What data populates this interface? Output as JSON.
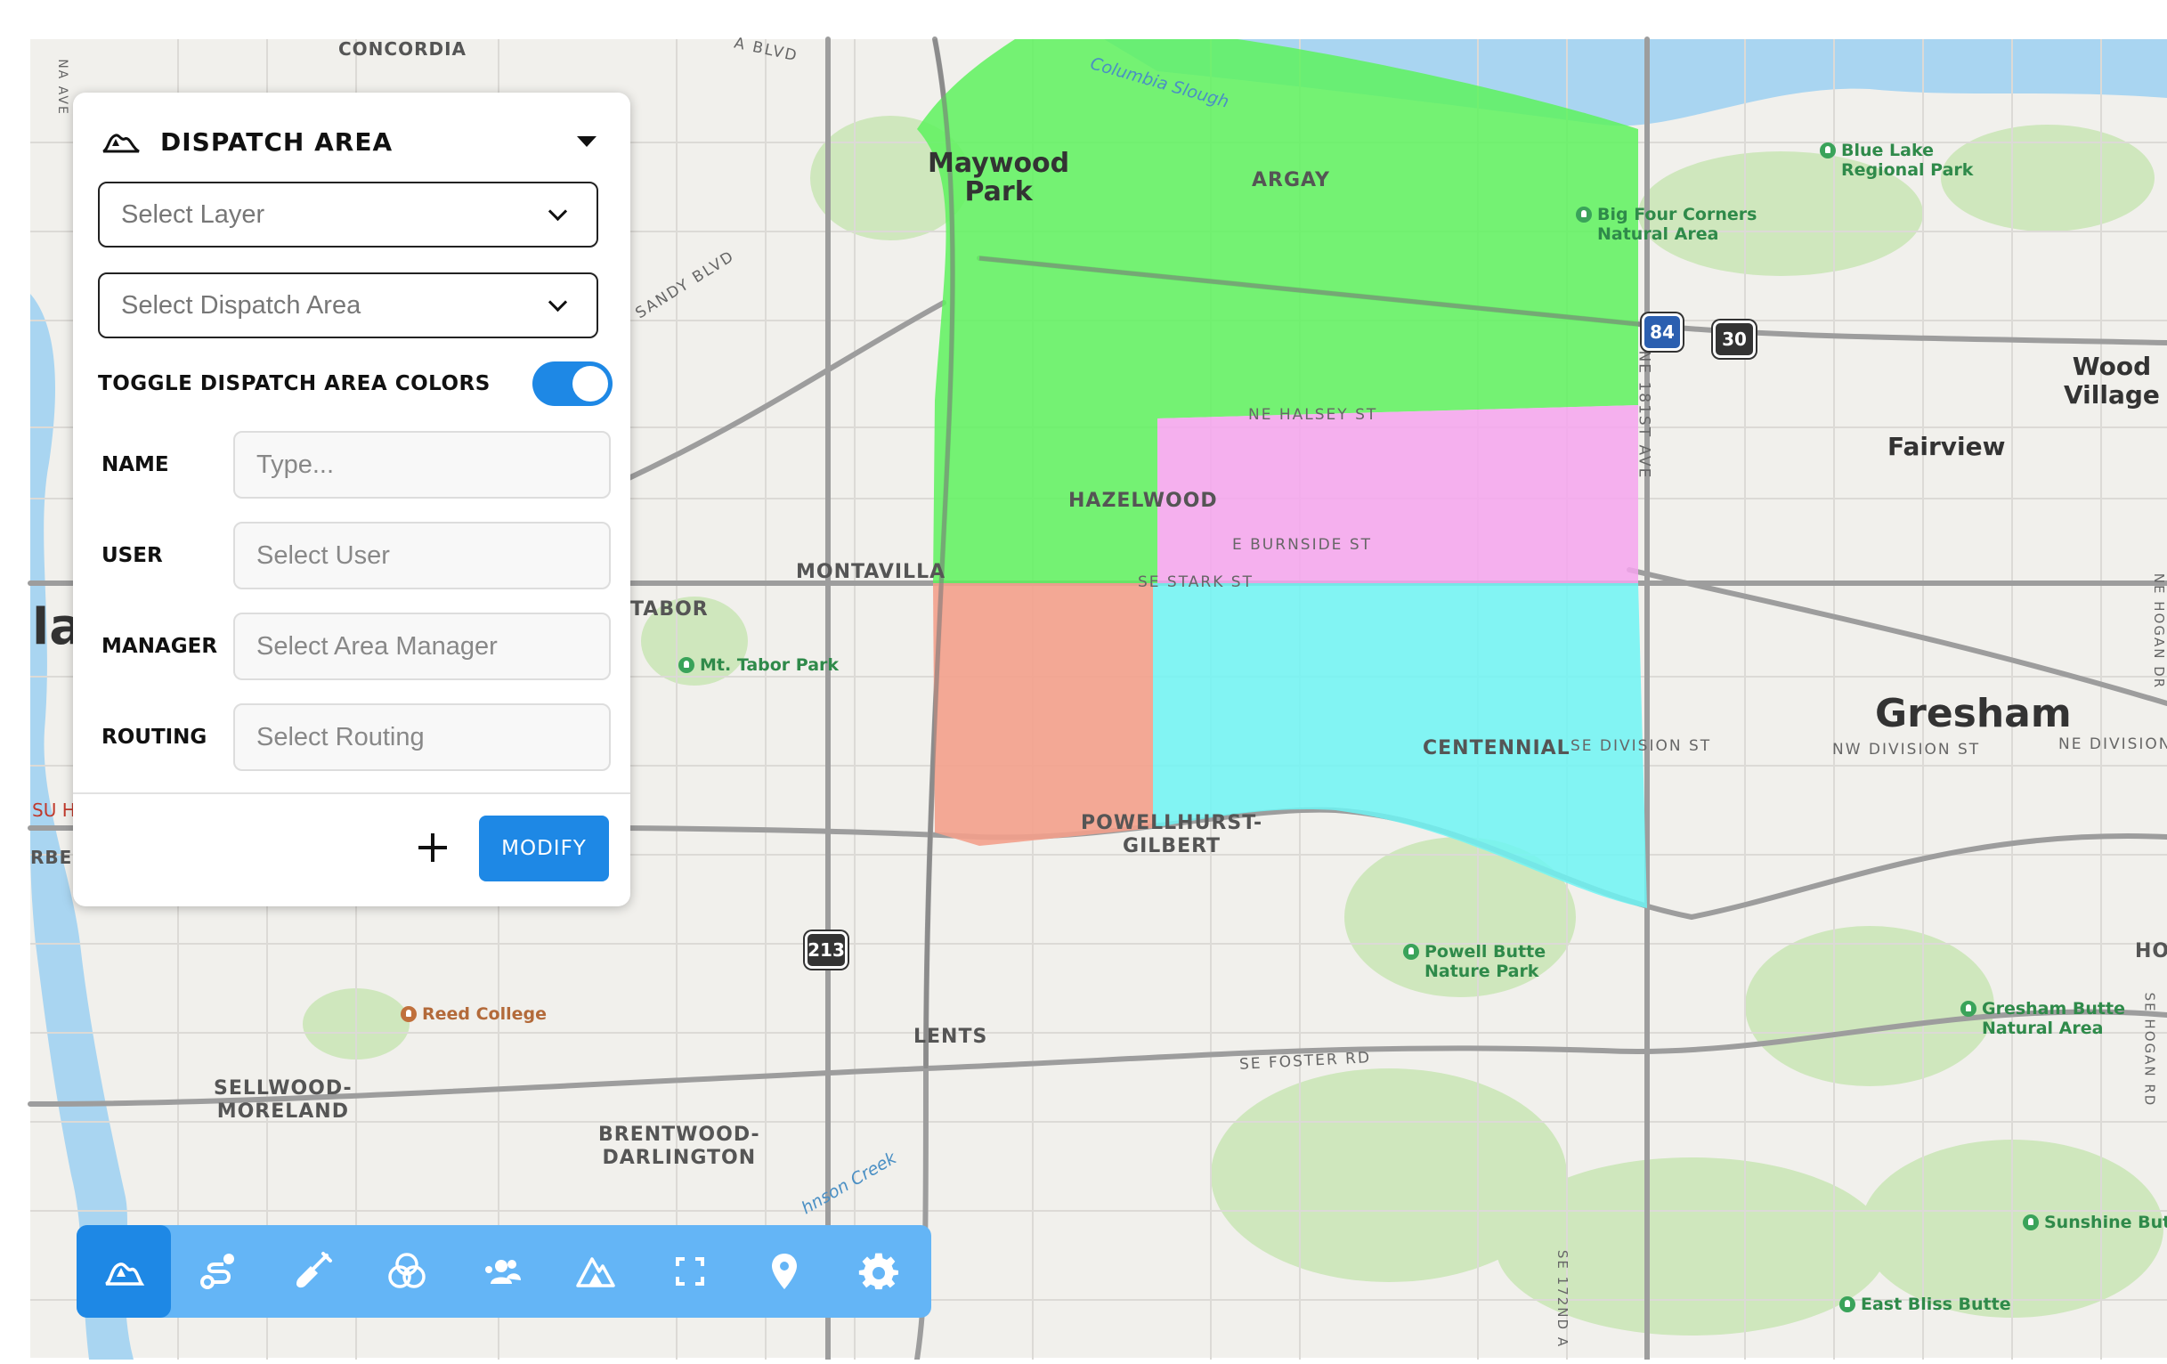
{
  "map": {
    "neighborhoods": [
      "CONCORDIA",
      "ARGAY",
      "HAZELWOOD",
      "MONTAVILLA",
      "TABOR",
      "CENTENNIAL",
      "POWELLHURST-\nGILBERT",
      "LENTS",
      "SELLWOOD-\nMORELAND",
      "BRENTWOOD-\nDARLINGTON",
      "HOG"
    ],
    "cities": [
      "Maywood\nPark",
      "Wood\nVillage",
      "Fairview",
      "Gresham"
    ],
    "streets": [
      "NE HALSEY ST",
      "E BURNSIDE ST",
      "SE STARK ST",
      "SE DIVISION ST",
      "NW DIVISION ST",
      "NE DIVISION",
      "SE FOSTER RD",
      "NE 181ST AVE",
      "SANDY BLVD",
      "A BLVD",
      "NA AVE",
      "SE 172ND A",
      "NE HOGAN DR",
      "SE HOGAN RD",
      "Columbia Slough",
      "hnson Creek"
    ],
    "pois": [
      "Blue Lake\nRegional Park",
      "Big Four Corners\nNatural Area",
      "Mt. Tabor Park",
      "Powell Butte\nNature Park",
      "Gresham Butte\nNatural Area",
      "Sunshine But",
      "East Bliss Butte",
      "Reed College"
    ],
    "fragments": [
      "lar",
      "SU Ho",
      "RBE"
    ],
    "shields": [
      "84",
      "30",
      "213"
    ],
    "zones": [
      {
        "id": "north",
        "color": "#5ef25e"
      },
      {
        "id": "central-east",
        "color": "#f6a4ee"
      },
      {
        "id": "southwest",
        "color": "#f3a08c"
      },
      {
        "id": "southeast",
        "color": "#6ef4f4"
      }
    ],
    "colors": {
      "land": "#f1f0ec",
      "water": "#a9d5f1",
      "park": "#cfe7bd",
      "road": "#9d9d9d",
      "road_major": "#8a8a8a"
    }
  },
  "panel": {
    "icon": "dispatch-area-icon",
    "title": "DISPATCH AREA",
    "layer_placeholder": "Select Layer",
    "area_placeholder": "Select Dispatch Area",
    "toggle_label": "TOGGLE DISPATCH AREA COLORS",
    "toggle_on": true,
    "fields": [
      {
        "label": "NAME",
        "placeholder": "Type..."
      },
      {
        "label": "USER",
        "placeholder": "Select User"
      },
      {
        "label": "MANAGER",
        "placeholder": "Select Area Manager"
      },
      {
        "label": "ROUTING",
        "placeholder": "Select Routing"
      }
    ],
    "add_icon": "plus-icon",
    "modify_label": "MODIFY",
    "accent": "#1e88e5"
  },
  "toolbar": {
    "background": "#64b5f6",
    "active": "#1e88e5",
    "tools": [
      "dispatch-area-icon",
      "route-icon",
      "shovel-icon",
      "overlap-circles-icon",
      "users-icon",
      "area-marker-icon",
      "fullscreen-icon",
      "location-pin-icon",
      "gear-icon"
    ]
  }
}
